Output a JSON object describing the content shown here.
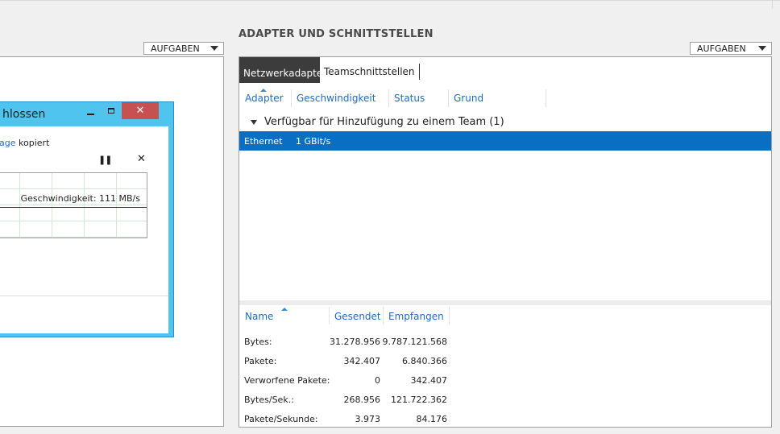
{
  "section": {
    "title": "ADAPTER UND SCHNITTSTELLEN"
  },
  "tasks": {
    "left_label": "AUFGABEN",
    "right_label": "AUFGABEN"
  },
  "copy_dialog": {
    "title": "hlossen",
    "info_link": "blage",
    "info_rest": " kopiert",
    "speed": "Geschwindigkeit: 111 MB/s"
  },
  "tabs": [
    {
      "label": "Netzwerkadapter",
      "active": true
    },
    {
      "label": "Teamschnittstellen",
      "active": false
    }
  ],
  "adapter_table": {
    "headers": [
      "Adapter",
      "Geschwindigkeit",
      "Status",
      "Grund"
    ],
    "group": "Verfügbar für Hinzufügung zu einem Team (1)",
    "rows": [
      {
        "adapter": "Ethernet",
        "speed": "1 GBit/s",
        "status": "",
        "reason": ""
      }
    ]
  },
  "stats_table": {
    "headers": [
      "Name",
      "Gesendet",
      "Empfangen"
    ],
    "rows": [
      {
        "name": "Bytes:",
        "sent": "31.278.956",
        "received": "9.787.121.568"
      },
      {
        "name": "Pakete:",
        "sent": "342.407",
        "received": "6.840.366"
      },
      {
        "name": "Verworfene Pakete:",
        "sent": "0",
        "received": "342.407"
      },
      {
        "name": "Bytes/Sek.:",
        "sent": "268.956",
        "received": "121.722.362"
      },
      {
        "name": "Pakete/Sekunde:",
        "sent": "3.973",
        "received": "84.176"
      }
    ]
  },
  "colors": {
    "selection": "#0a6fc2",
    "header_link": "#1c6bbf",
    "dialog_frame": "#4fc4ee",
    "close_button": "#c75050"
  }
}
